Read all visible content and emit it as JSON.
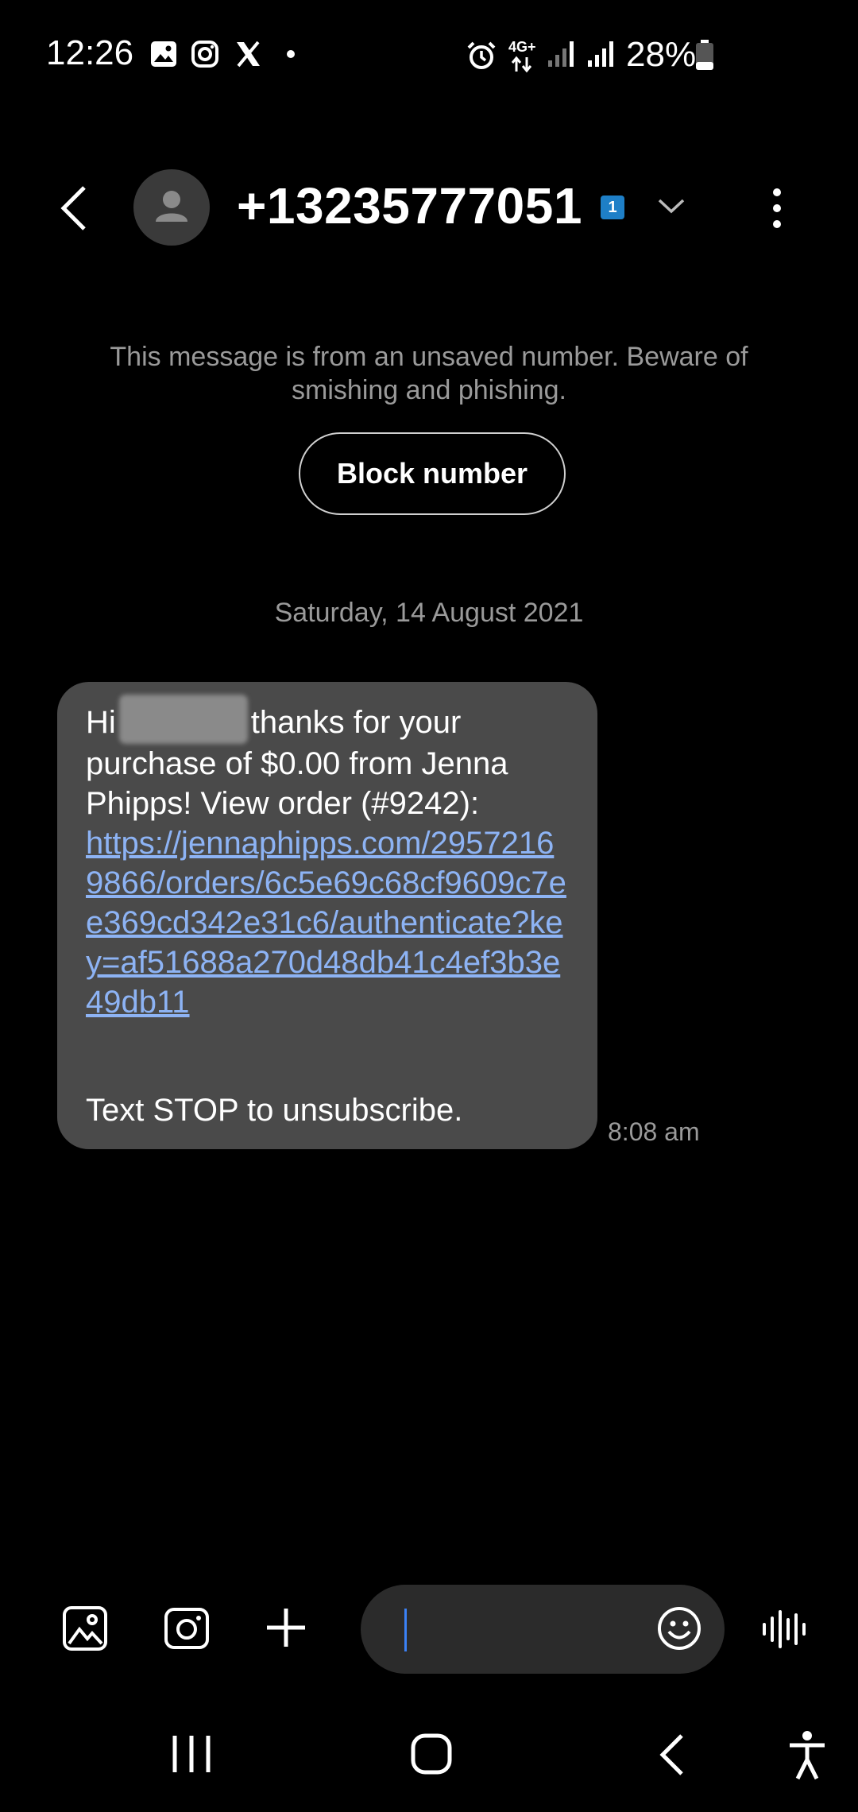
{
  "status_bar": {
    "time": "12:26",
    "network": "4G+",
    "battery": "28%",
    "icons": [
      "gallery-icon",
      "instagram-icon",
      "x-icon",
      "dot-icon",
      "alarm-icon",
      "signal-icon",
      "signal-icon",
      "battery-icon"
    ]
  },
  "header": {
    "phone_number": "+13235777051",
    "sim_badge": "1"
  },
  "notice": {
    "text": "This message is from an unsaved number. Beware of smishing and phishing.",
    "block_button": "Block number"
  },
  "conversation": {
    "date": "Saturday, 14 August 2021",
    "message": {
      "greeting": "Hi",
      "text_after_name": "thanks for your purchase of $0.00 from Jenna Phipps!  View order (#9242):",
      "link": "https://jennaphipps.com/29572169866/orders/6c5e69c68cf9609c7ee369cd342e31c6/authenticate?key=af51688a270d48db41c4ef3b3e49db11",
      "footer": "Text STOP to unsubscribe.",
      "time": "8:08 am"
    }
  },
  "composer": {
    "input_value": ""
  },
  "colors": {
    "background": "#000000",
    "bubble": "#4a4a4a",
    "link": "#8db3f4",
    "badge": "#1e7fc7",
    "cursor": "#3b82f6"
  }
}
